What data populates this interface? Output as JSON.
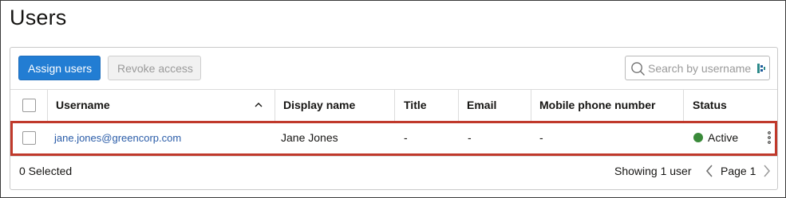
{
  "page": {
    "title": "Users"
  },
  "toolbar": {
    "assign_label": "Assign users",
    "revoke_label": "Revoke access",
    "search_placeholder": "Search by username"
  },
  "table": {
    "columns": [
      "Username",
      "Display name",
      "Title",
      "Email",
      "Mobile phone number",
      "Status"
    ],
    "rows": [
      {
        "username": "jane.jones@greencorp.com",
        "display_name": "Jane Jones",
        "title": "-",
        "email": "-",
        "mobile": "-",
        "status": "Active"
      }
    ]
  },
  "footer": {
    "selected": "0 Selected",
    "showing": "Showing 1 user",
    "page": "Page 1"
  },
  "colors": {
    "primary": "#227dd3",
    "status_active": "#3a8a3a",
    "highlight": "#c0392b",
    "link": "#2a5ca8"
  },
  "icons": [
    "search-icon",
    "extension-icon",
    "sort-ascending-icon",
    "status-active-dot",
    "kebab-menu-icon",
    "chevron-left-icon",
    "chevron-right-icon"
  ]
}
